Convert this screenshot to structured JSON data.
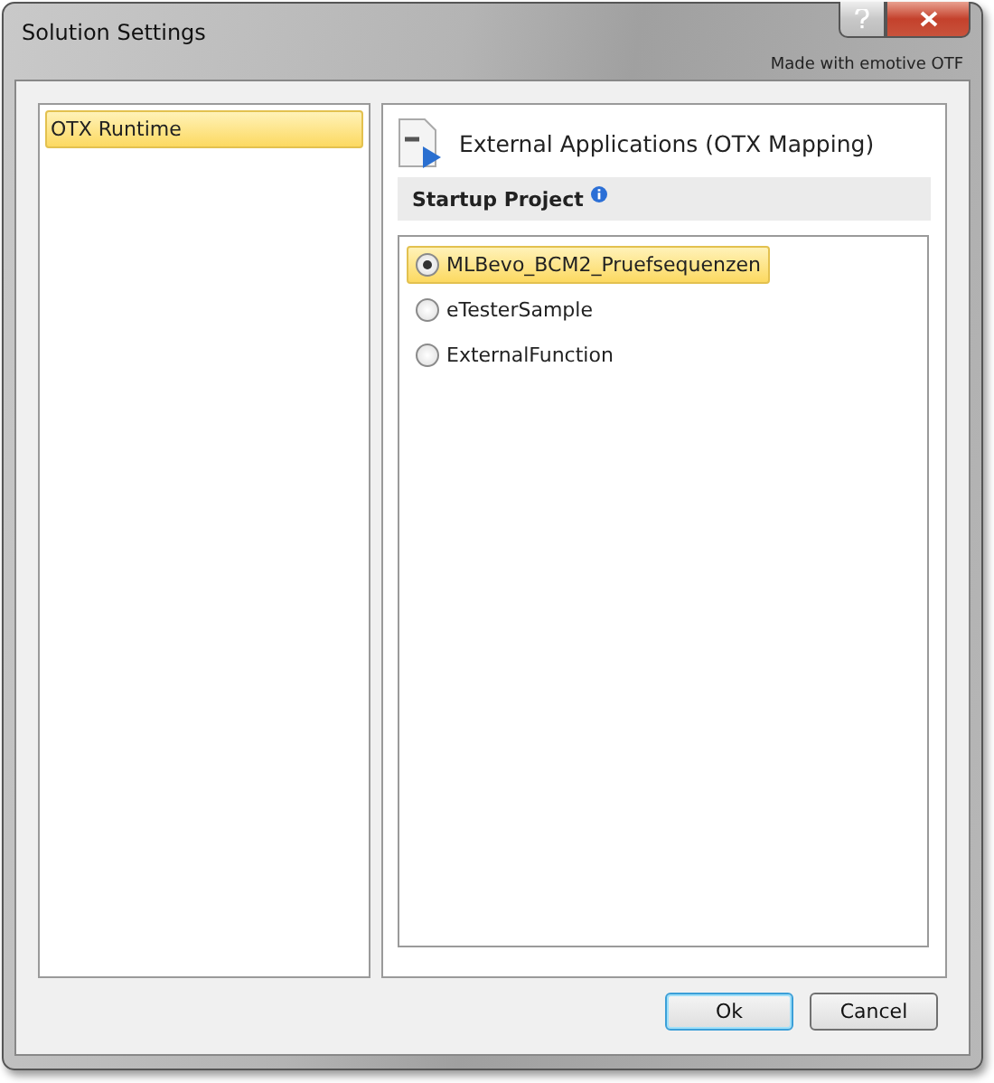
{
  "window": {
    "title": "Solution Settings",
    "subtitle": "Made with emotive OTF"
  },
  "sidebar": {
    "items": [
      {
        "label": "OTX Runtime",
        "selected": true
      }
    ]
  },
  "panel": {
    "title": "External Applications (OTX Mapping)",
    "section": "Startup Project",
    "projects": [
      {
        "label": "MLBevo_BCM2_Pruefsequenzen",
        "selected": true
      },
      {
        "label": "eTesterSample",
        "selected": false
      },
      {
        "label": "ExternalFunction",
        "selected": false
      }
    ]
  },
  "buttons": [
    {
      "label": "Ok",
      "kind": "default"
    },
    {
      "label": "Cancel",
      "kind": "normal"
    }
  ]
}
